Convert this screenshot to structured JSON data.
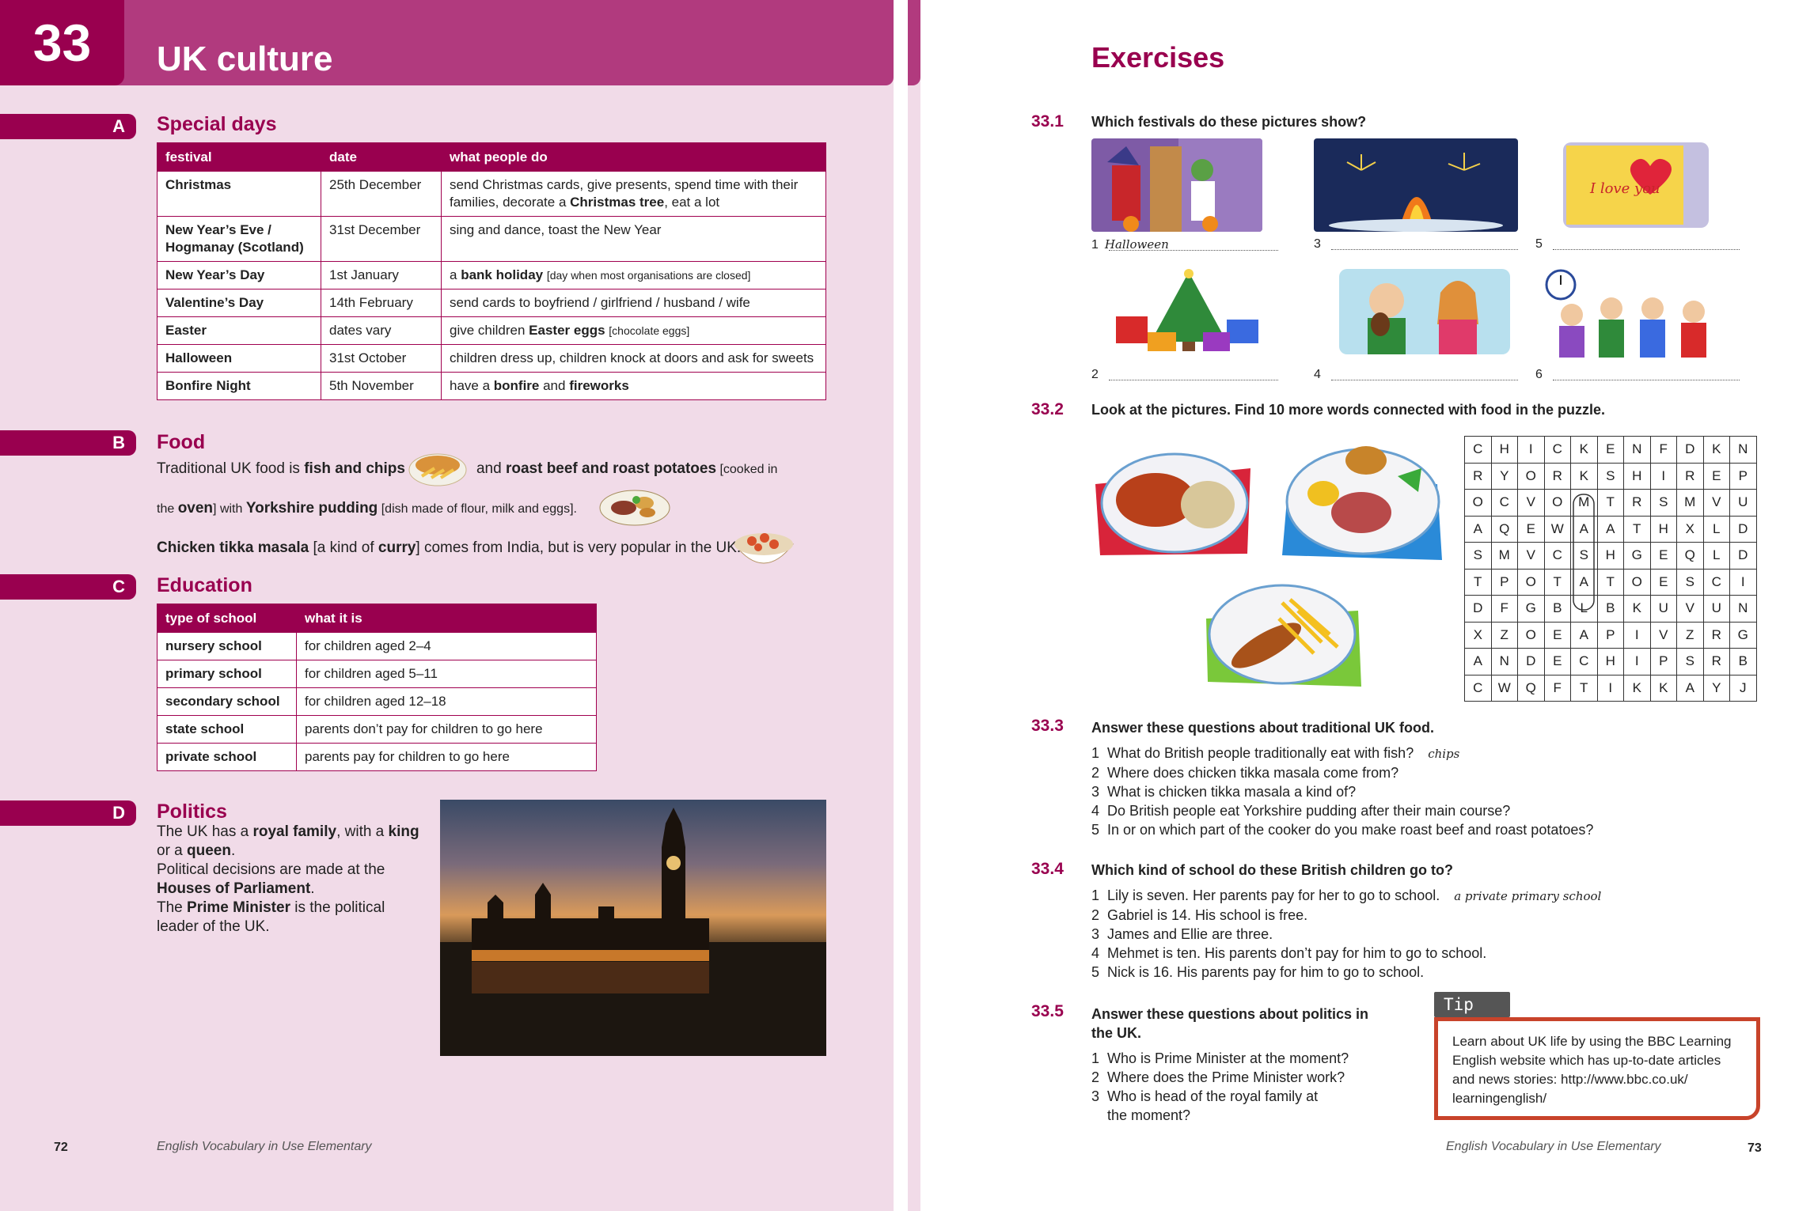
{
  "unit": {
    "number": "33",
    "title": "UK culture"
  },
  "sections": {
    "a": {
      "letter": "A",
      "title": "Special days"
    },
    "b": {
      "letter": "B",
      "title": "Food"
    },
    "c": {
      "letter": "C",
      "title": "Education"
    },
    "d": {
      "letter": "D",
      "title": "Politics"
    }
  },
  "special_days": {
    "headers": [
      "festival",
      "date",
      "what people do"
    ],
    "rows": [
      {
        "festival": "Christmas",
        "date": "25th December",
        "what": "send Christmas cards, give presents, spend time with their families, decorate a ",
        "bold": "Christmas tree",
        "after": ", eat a lot"
      },
      {
        "festival": "New Year’s Eve / Hogmanay (Scotland)",
        "date": "31st December",
        "what": "sing and dance, toast the New Year",
        "bold": "",
        "after": ""
      },
      {
        "festival": "New Year’s Day",
        "date": "1st January",
        "what": "a ",
        "bold": "bank holiday",
        "after": " ",
        "small": "[day when most organisations are closed]"
      },
      {
        "festival": "Valentine’s Day",
        "date": "14th February",
        "what": "send cards to boyfriend / girlfriend / husband / wife",
        "bold": "",
        "after": ""
      },
      {
        "festival": "Easter",
        "date": "dates vary",
        "what": "give children ",
        "bold": "Easter eggs",
        "after": " ",
        "small": "[chocolate eggs]"
      },
      {
        "festival": "Halloween",
        "date": "31st October",
        "what": "children dress up, children knock at doors and ask for sweets",
        "bold": "",
        "after": ""
      },
      {
        "festival": "Bonfire Night",
        "date": "5th November",
        "what": "have a ",
        "bold": "bonfire",
        "after": " and ",
        "bold2": "fireworks"
      }
    ]
  },
  "food": {
    "l1a": "Traditional UK food is ",
    "l1b": "fish and chips",
    "l1c": "and ",
    "l1d": "roast beef and roast potatoes",
    "l1e": " [cooked in",
    "l2a": "the ",
    "l2b": "oven",
    "l2c": "] with ",
    "l2d": "Yorkshire pudding",
    "l2e": " [dish made of flour, milk and eggs].",
    "l3a": "Chicken tikka masala",
    "l3b": " [a kind of ",
    "l3c": "curry",
    "l3d": "] comes from India, but is very popular in the UK."
  },
  "education": {
    "headers": [
      "type of school",
      "what it is"
    ],
    "rows": [
      {
        "type": "nursery school",
        "what": "for children aged 2–4"
      },
      {
        "type": "primary school",
        "what": "for children aged 5–11"
      },
      {
        "type": "secondary school",
        "what": "for children aged 12–18"
      },
      {
        "type": "state school",
        "what": "parents don’t pay for children to go here"
      },
      {
        "type": "private school",
        "what": "parents pay for children to go here"
      }
    ]
  },
  "politics": {
    "p1": "The UK has a ",
    "p2": "royal family",
    "p3": ", with a ",
    "p4": "king",
    "p5": "or a ",
    "p6": "queen",
    "p7": ".",
    "p8": "Political decisions are made at the ",
    "p9": "Houses of Parliament",
    "p10": ".",
    "p11": "The ",
    "p12": "Prime Minister",
    "p13": " is the political leader of the UK."
  },
  "footer": {
    "left_num": "72",
    "left_title": "English Vocabulary in Use Elementary",
    "right_title": "English Vocabulary in Use Elementary",
    "right_num": "73"
  },
  "exercises": {
    "title": "Exercises",
    "e1": {
      "num": "33.1",
      "q": "Which festivals do these pictures show?",
      "labels": [
        "1",
        "2",
        "3",
        "4",
        "5",
        "6"
      ],
      "answer1": "Halloween"
    },
    "e2": {
      "num": "33.2",
      "q": "Look at the pictures. Find 10 more words connected with food in the puzzle."
    },
    "e3": {
      "num": "33.3",
      "q": "Answer these questions about traditional UK food.",
      "items": [
        "What do British people traditionally eat with fish?",
        "Where does chicken tikka masala come from?",
        "What is chicken tikka masala a kind of?",
        "Do British people eat Yorkshire pudding after their main course?",
        "In or on which part of the cooker do you make roast beef and roast potatoes?"
      ],
      "answer1": "chips"
    },
    "e4": {
      "num": "33.4",
      "q": "Which kind of school do these British children go to?",
      "items": [
        "Lily is seven. Her parents pay for her to go to school.",
        "Gabriel is 14. His school is free.",
        "James and Ellie are three.",
        "Mehmet is ten. His parents don’t pay for him to go to school.",
        "Nick is 16. His parents pay for him to go to school."
      ],
      "answer1": "a private primary school"
    },
    "e5": {
      "num": "33.5",
      "q1": "Answer these questions about politics in",
      "q2": "the UK.",
      "items": [
        "Who is Prime Minister at the moment?",
        "Where does the Prime Minister work?",
        "Who is head of the royal family at"
      ],
      "cont": "the moment?"
    }
  },
  "puzzle": [
    [
      "C",
      "H",
      "I",
      "C",
      "K",
      "E",
      "N",
      "F",
      "D",
      "K",
      "N"
    ],
    [
      "R",
      "Y",
      "O",
      "R",
      "K",
      "S",
      "H",
      "I",
      "R",
      "E",
      "P"
    ],
    [
      "O",
      "C",
      "V",
      "O",
      "M",
      "T",
      "R",
      "S",
      "M",
      "V",
      "U"
    ],
    [
      "A",
      "Q",
      "E",
      "W",
      "A",
      "A",
      "T",
      "H",
      "X",
      "L",
      "D"
    ],
    [
      "S",
      "M",
      "V",
      "C",
      "S",
      "H",
      "G",
      "E",
      "Q",
      "L",
      "D"
    ],
    [
      "T",
      "P",
      "O",
      "T",
      "A",
      "T",
      "O",
      "E",
      "S",
      "C",
      "I"
    ],
    [
      "D",
      "F",
      "G",
      "B",
      "L",
      "B",
      "K",
      "U",
      "V",
      "U",
      "N"
    ],
    [
      "X",
      "Z",
      "O",
      "E",
      "A",
      "P",
      "I",
      "V",
      "Z",
      "R",
      "G"
    ],
    [
      "A",
      "N",
      "D",
      "E",
      "C",
      "H",
      "I",
      "P",
      "S",
      "R",
      "B"
    ],
    [
      "C",
      "W",
      "Q",
      "F",
      "T",
      "I",
      "K",
      "K",
      "A",
      "Y",
      "J"
    ]
  ],
  "tip": {
    "label": "Tip",
    "text": "Learn about UK life by using the BBC Learning English website which has up-to-date articles and news stories: http://www.bbc.co.uk/ learningenglish/"
  },
  "card_text": "I love you"
}
